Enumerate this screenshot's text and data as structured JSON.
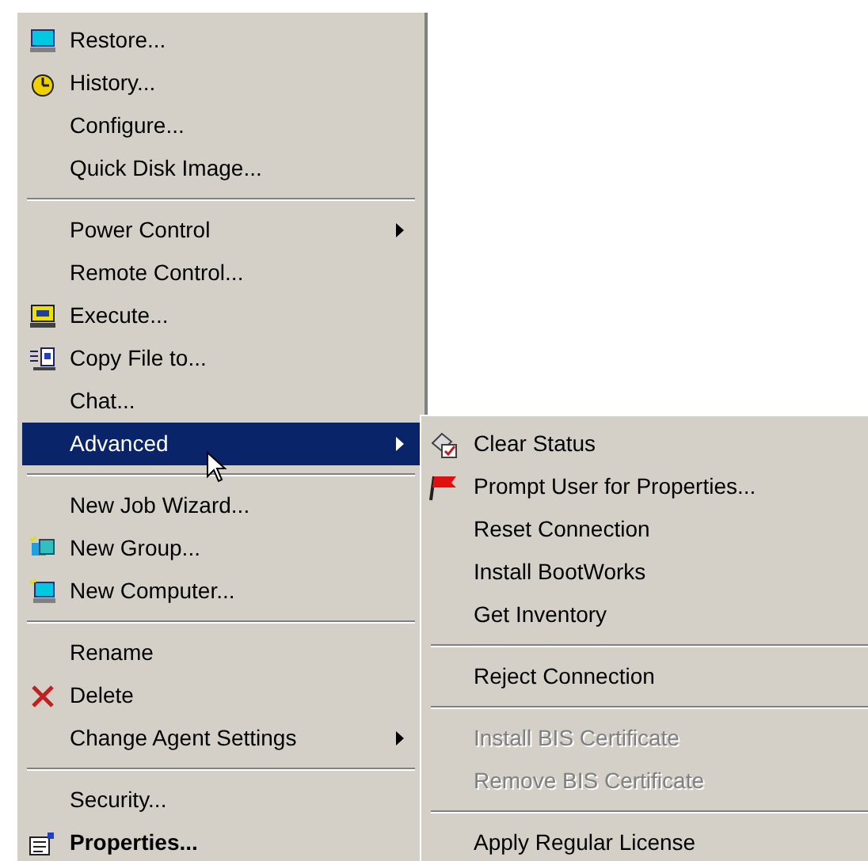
{
  "menu": {
    "items": [
      {
        "kind": "computer",
        "label": "Restore...",
        "selected": false,
        "has_submenu": false,
        "bold": false
      },
      {
        "kind": "clock",
        "label": "History...",
        "selected": false,
        "has_submenu": false,
        "bold": false
      },
      {
        "kind": "plain",
        "label": "Configure...",
        "selected": false,
        "has_submenu": false,
        "bold": false
      },
      {
        "kind": "plain",
        "label": "Quick Disk Image...",
        "selected": false,
        "has_submenu": false,
        "bold": false
      },
      {
        "kind": "separator"
      },
      {
        "kind": "plain",
        "label": "Power Control",
        "selected": false,
        "has_submenu": true,
        "bold": false
      },
      {
        "kind": "plain",
        "label": "Remote Control...",
        "selected": false,
        "has_submenu": false,
        "bold": false
      },
      {
        "kind": "execute",
        "label": "Execute...",
        "selected": false,
        "has_submenu": false,
        "bold": false
      },
      {
        "kind": "copy",
        "label": "Copy File to...",
        "selected": false,
        "has_submenu": false,
        "bold": false
      },
      {
        "kind": "plain",
        "label": "Chat...",
        "selected": false,
        "has_submenu": false,
        "bold": false
      },
      {
        "kind": "plain",
        "label": "Advanced",
        "selected": true,
        "has_submenu": true,
        "bold": false
      },
      {
        "kind": "separator"
      },
      {
        "kind": "plain",
        "label": "New Job Wizard...",
        "selected": false,
        "has_submenu": false,
        "bold": false
      },
      {
        "kind": "group",
        "label": "New Group...",
        "selected": false,
        "has_submenu": false,
        "bold": false
      },
      {
        "kind": "new-computer",
        "label": "New Computer...",
        "selected": false,
        "has_submenu": false,
        "bold": false
      },
      {
        "kind": "separator"
      },
      {
        "kind": "plain",
        "label": "Rename",
        "selected": false,
        "has_submenu": false,
        "bold": false
      },
      {
        "kind": "delete",
        "label": "Delete",
        "selected": false,
        "has_submenu": false,
        "bold": false
      },
      {
        "kind": "plain",
        "label": "Change Agent Settings",
        "selected": false,
        "has_submenu": true,
        "bold": false
      },
      {
        "kind": "separator"
      },
      {
        "kind": "plain",
        "label": "Security...",
        "selected": false,
        "has_submenu": false,
        "bold": false
      },
      {
        "kind": "properties",
        "label": "Properties...",
        "selected": false,
        "has_submenu": false,
        "bold": true
      }
    ]
  },
  "submenu": {
    "items": [
      {
        "kind": "clear",
        "label": "Clear Status",
        "disabled": false
      },
      {
        "kind": "flag",
        "label": "Prompt User for Properties...",
        "disabled": false
      },
      {
        "kind": "plain",
        "label": "Reset Connection",
        "disabled": false
      },
      {
        "kind": "plain",
        "label": "Install BootWorks",
        "disabled": false
      },
      {
        "kind": "plain",
        "label": "Get Inventory",
        "disabled": false
      },
      {
        "kind": "separator"
      },
      {
        "kind": "plain",
        "label": "Reject Connection",
        "disabled": false
      },
      {
        "kind": "separator"
      },
      {
        "kind": "plain",
        "label": "Install BIS Certificate",
        "disabled": true
      },
      {
        "kind": "plain",
        "label": "Remove BIS Certificate",
        "disabled": true
      },
      {
        "kind": "separator"
      },
      {
        "kind": "plain",
        "label": "Apply Regular License",
        "disabled": false
      }
    ]
  }
}
